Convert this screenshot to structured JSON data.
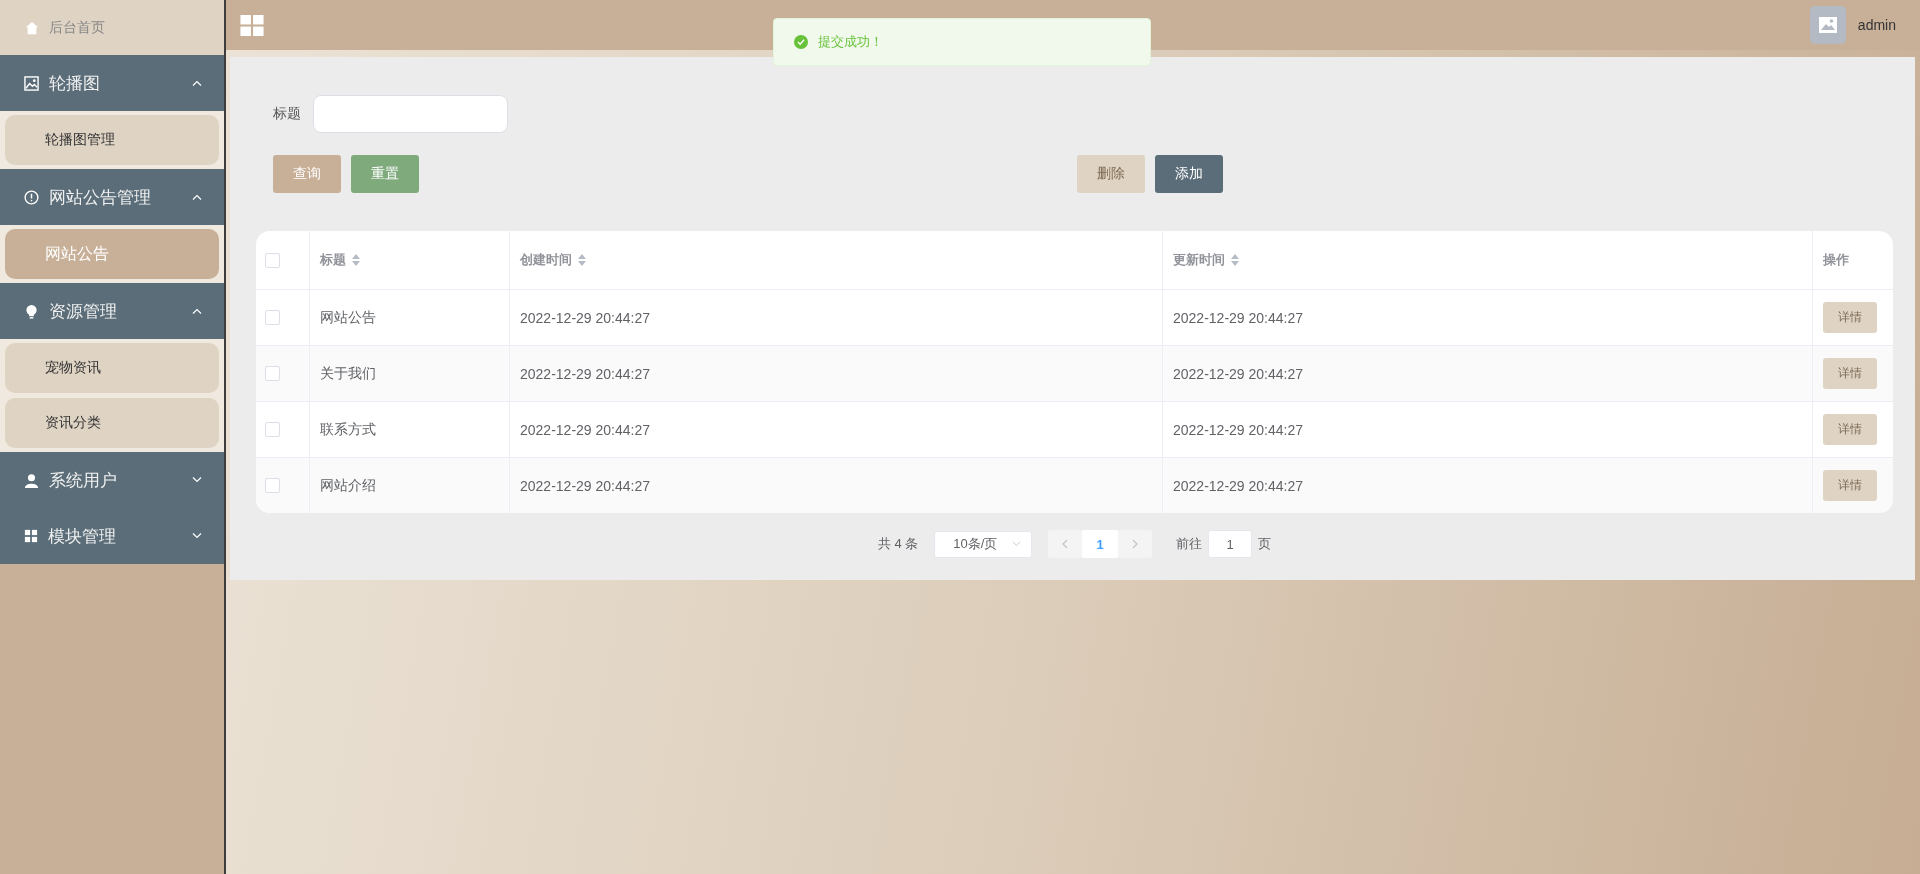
{
  "sidebar": {
    "home": {
      "label": "后台首页"
    },
    "groups": [
      {
        "label": "轮播图",
        "kind": "image",
        "expanded": true,
        "items": [
          {
            "label": "轮播图管理",
            "selected": false
          }
        ]
      },
      {
        "label": "网站公告管理",
        "kind": "info",
        "expanded": true,
        "items": [
          {
            "label": "网站公告",
            "selected": true
          }
        ]
      },
      {
        "label": "资源管理",
        "kind": "bulb",
        "expanded": true,
        "items": [
          {
            "label": "宠物资讯",
            "selected": false
          },
          {
            "label": "资讯分类",
            "selected": false
          }
        ]
      },
      {
        "label": "系统用户",
        "kind": "user",
        "expanded": false
      },
      {
        "label": "模块管理",
        "kind": "grid",
        "expanded": false
      }
    ]
  },
  "header": {
    "user": "admin"
  },
  "toast": {
    "message": "提交成功！"
  },
  "filter": {
    "label": "标题",
    "left_buttons": [
      {
        "label": "查询",
        "kind": "query"
      },
      {
        "label": "重置",
        "kind": "reset"
      }
    ],
    "right_buttons": [
      {
        "label": "删除",
        "kind": "delete"
      },
      {
        "label": "添加",
        "kind": "add"
      }
    ]
  },
  "table": {
    "all_checked": false,
    "columns": [
      {
        "label": "标题",
        "sortable": true
      },
      {
        "label": "创建时间",
        "sortable": true
      },
      {
        "label": "更新时间",
        "sortable": true
      },
      {
        "label": "操作",
        "sortable": false
      }
    ],
    "rows": [
      {
        "checked": false,
        "title": "网站公告",
        "created": "2022-12-29 20:44:27",
        "updated": "2022-12-29 20:44:27",
        "action": "详情"
      },
      {
        "checked": false,
        "title": "关于我们",
        "created": "2022-12-29 20:44:27",
        "updated": "2022-12-29 20:44:27",
        "action": "详情"
      },
      {
        "checked": false,
        "title": "联系方式",
        "created": "2022-12-29 20:44:27",
        "updated": "2022-12-29 20:44:27",
        "action": "详情"
      },
      {
        "checked": false,
        "title": "网站介绍",
        "created": "2022-12-29 20:44:27",
        "updated": "2022-12-29 20:44:27",
        "action": "详情"
      }
    ]
  },
  "pagination": {
    "total": "共 4 条",
    "page_size": "10条/页",
    "pages": [
      {
        "label": "1",
        "selected": true
      }
    ],
    "goto_label": "前往",
    "goto_value": "1",
    "goto_suffix": "页"
  }
}
